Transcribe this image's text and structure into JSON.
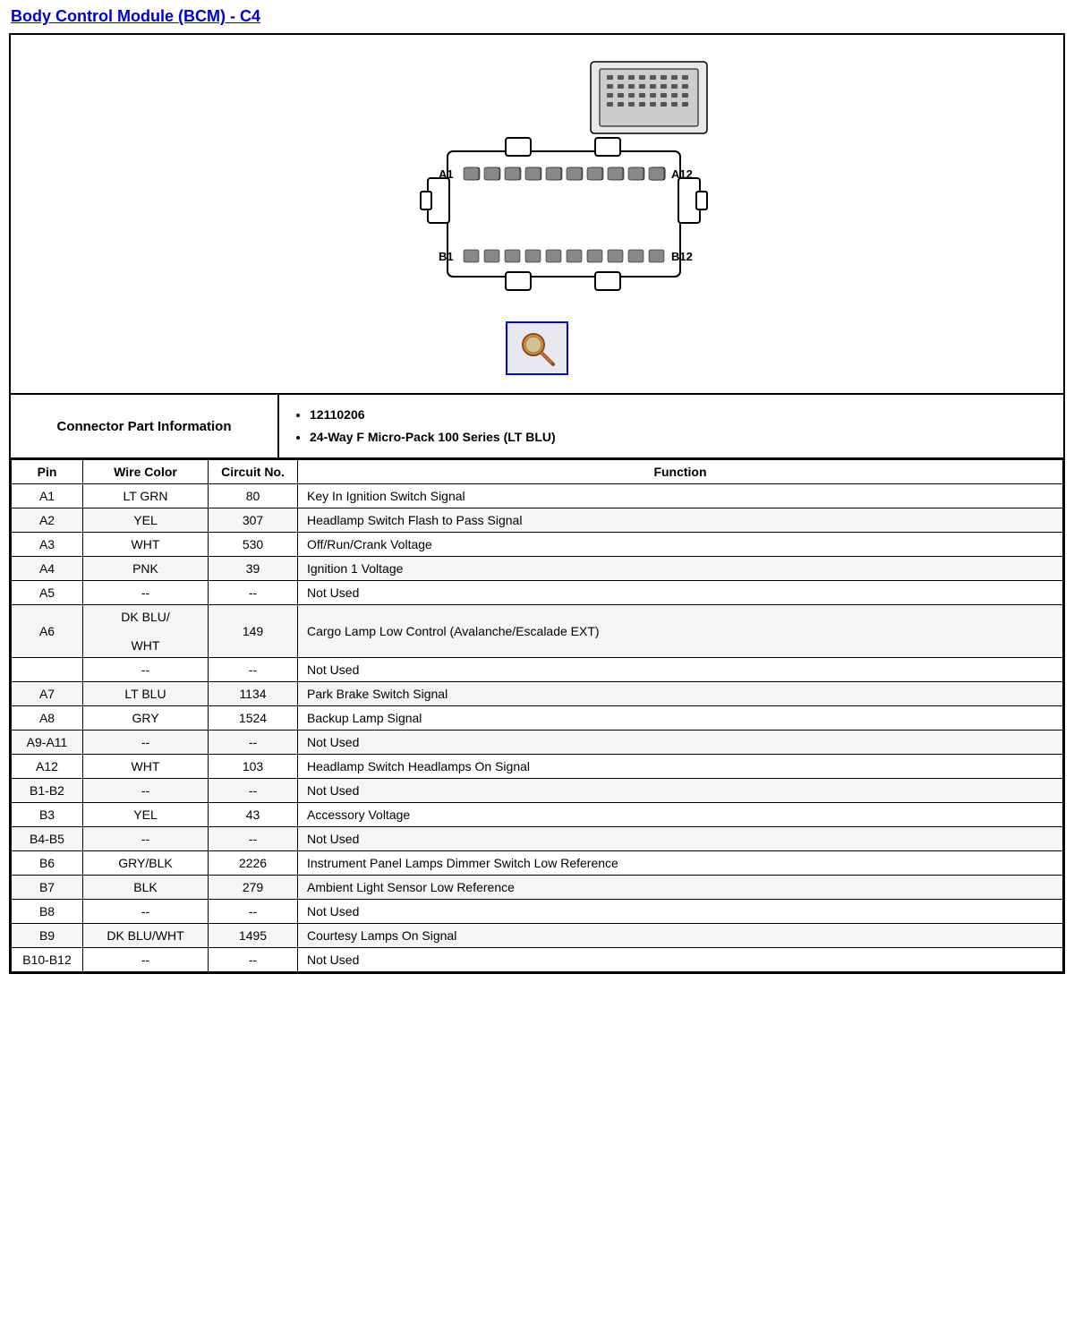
{
  "title": "Body Control Module (BCM) - C4",
  "connector_part_label": "Connector Part Information",
  "connector_parts": [
    "12110206",
    "24-Way F Micro-Pack 100 Series (LT BLU)"
  ],
  "table_headers": [
    "Pin",
    "Wire Color",
    "Circuit No.",
    "Function"
  ],
  "rows": [
    {
      "pin": "A1",
      "wire": "LT GRN",
      "circuit": "80",
      "function": "Key In Ignition Switch Signal"
    },
    {
      "pin": "A2",
      "wire": "YEL",
      "circuit": "307",
      "function": "Headlamp Switch Flash to Pass Signal"
    },
    {
      "pin": "A3",
      "wire": "WHT",
      "circuit": "530",
      "function": "Off/Run/Crank Voltage"
    },
    {
      "pin": "A4",
      "wire": "PNK",
      "circuit": "39",
      "function": "Ignition 1 Voltage"
    },
    {
      "pin": "A5",
      "wire": "--",
      "circuit": "--",
      "function": "Not Used"
    },
    {
      "pin": "A6",
      "wire": "DK BLU/\n\nWHT",
      "circuit": "149",
      "function": "Cargo Lamp Low Control (Avalanche/Escalade EXT)"
    },
    {
      "pin": "",
      "wire": "--",
      "circuit": "--",
      "function": "Not Used"
    },
    {
      "pin": "A7",
      "wire": "LT BLU",
      "circuit": "1134",
      "function": "Park Brake Switch Signal"
    },
    {
      "pin": "A8",
      "wire": "GRY",
      "circuit": "1524",
      "function": "Backup Lamp Signal"
    },
    {
      "pin": "A9-A11",
      "wire": "--",
      "circuit": "--",
      "function": "Not Used"
    },
    {
      "pin": "A12",
      "wire": "WHT",
      "circuit": "103",
      "function": "Headlamp Switch Headlamps On Signal"
    },
    {
      "pin": "B1-B2",
      "wire": "--",
      "circuit": "--",
      "function": "Not Used"
    },
    {
      "pin": "B3",
      "wire": "YEL",
      "circuit": "43",
      "function": "Accessory Voltage"
    },
    {
      "pin": "B4-B5",
      "wire": "--",
      "circuit": "--",
      "function": "Not Used"
    },
    {
      "pin": "B6",
      "wire": "GRY/BLK",
      "circuit": "2226",
      "function": "Instrument Panel Lamps Dimmer Switch Low Reference"
    },
    {
      "pin": "B7",
      "wire": "BLK",
      "circuit": "279",
      "function": "Ambient Light Sensor Low Reference"
    },
    {
      "pin": "B8",
      "wire": "--",
      "circuit": "--",
      "function": "Not Used"
    },
    {
      "pin": "B9",
      "wire": "DK BLU/WHT",
      "circuit": "1495",
      "function": "Courtesy Lamps On Signal"
    },
    {
      "pin": "B10-B12",
      "wire": "--",
      "circuit": "--",
      "function": "Not Used"
    }
  ],
  "diagram": {
    "label_a1": "A1",
    "label_a12": "A12",
    "label_b1": "B1",
    "label_b12": "B12"
  }
}
